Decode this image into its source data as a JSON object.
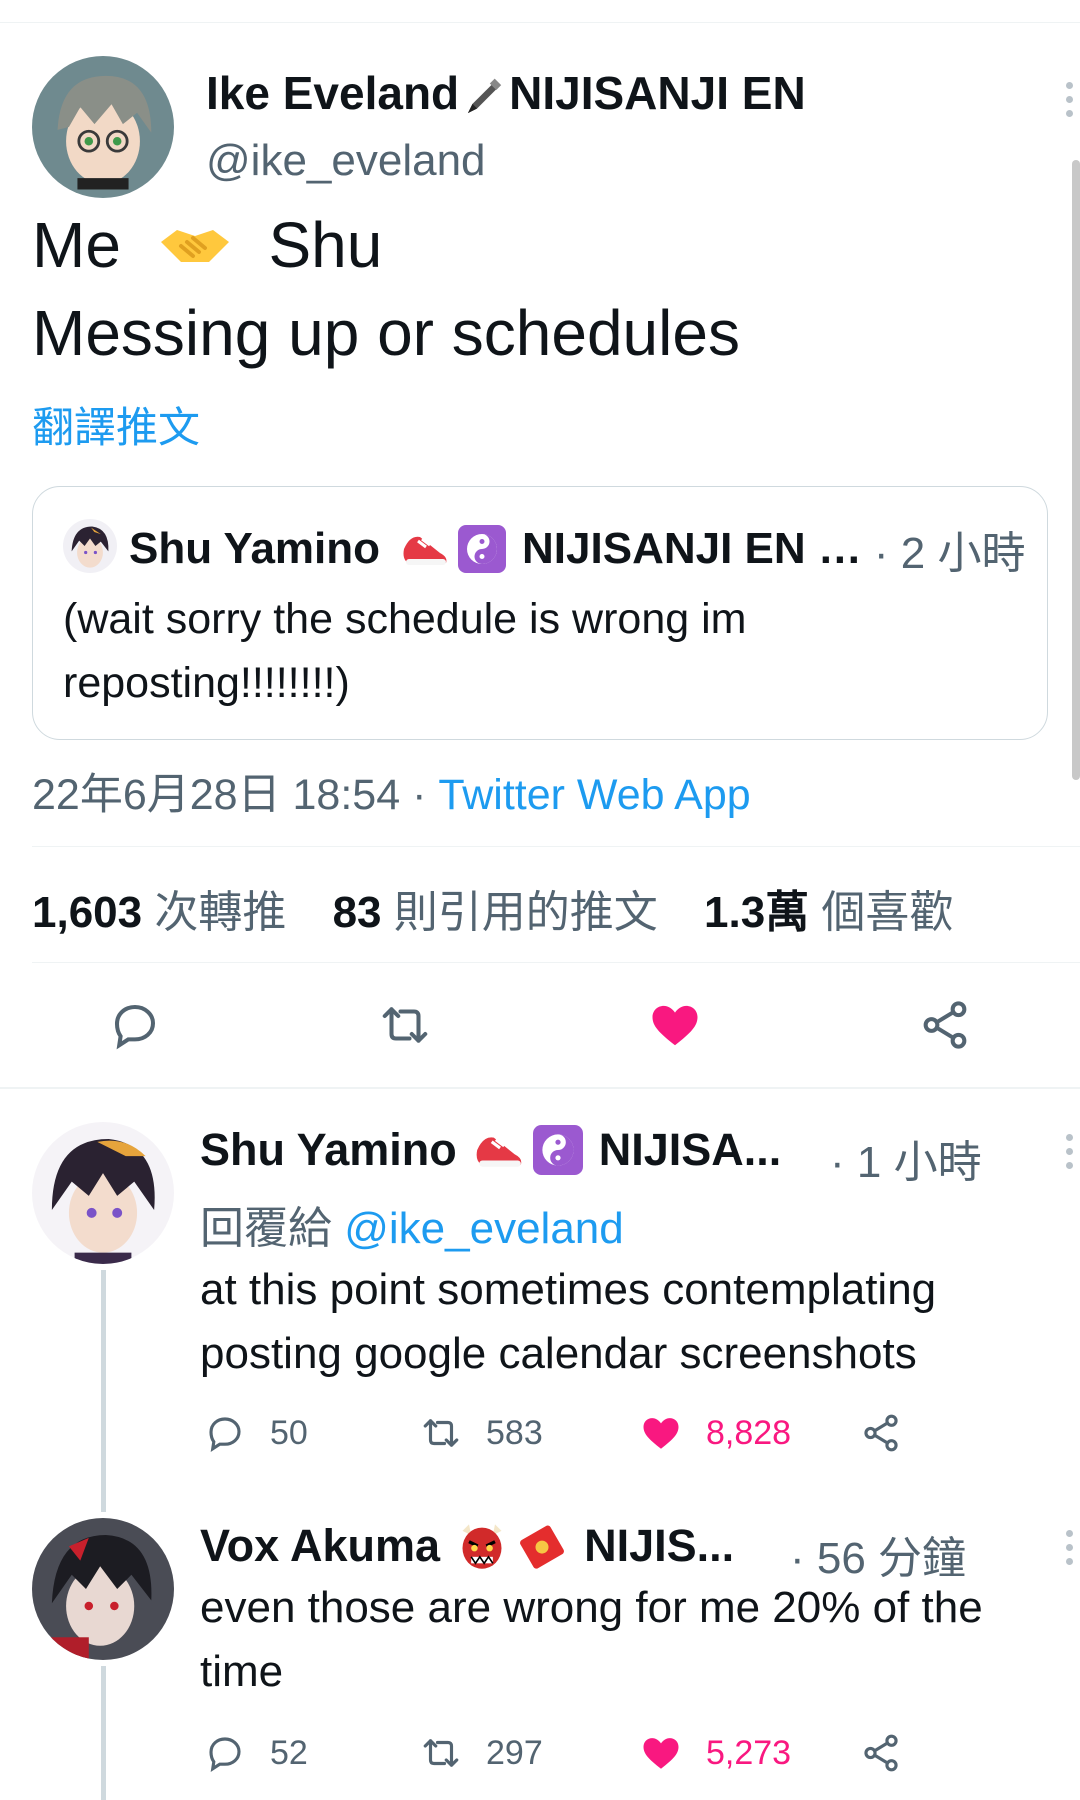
{
  "main_tweet": {
    "author_name": "Ike Eveland",
    "name_emoji": "🖋",
    "org": "NIJISANJI EN",
    "handle": "@ike_eveland",
    "text_line1_a": "Me",
    "text_line1_emoji": "🤝",
    "text_line1_b": "Shu",
    "text_line2": "Messing up or schedules",
    "translate_label": "翻譯推文",
    "timestamp": "22年6月28日 18:54",
    "separator": "·",
    "source_app": "Twitter Web App",
    "stats": {
      "retweets_count": "1,603",
      "retweets_label": "次轉推",
      "quotes_count": "83",
      "quotes_label": "則引用的推文",
      "likes_count": "1.3萬",
      "likes_label": "個喜歡"
    }
  },
  "quoted_tweet": {
    "author_name": "Shu Yamino",
    "org_truncated": "NIJISANJI EN …",
    "dot": "·",
    "time": "2 小時",
    "text": "(wait sorry the schedule is wrong im reposting!!!!!!!!)"
  },
  "replies": [
    {
      "author_name": "Shu Yamino",
      "org_truncated": "NIJISA...",
      "time": "· 1 小時",
      "reply_prefix": "回覆給",
      "reply_to": "@ike_eveland",
      "text": "at this point sometimes contemplating posting google calendar screenshots",
      "reply_count": "50",
      "retweet_count": "583",
      "like_count": "8,828"
    },
    {
      "author_name": "Vox Akuma",
      "org_truncated": "NIJIS...",
      "time": "· 56 分鐘",
      "text": "even those are wrong for me 20% of the time",
      "reply_count": "52",
      "retweet_count": "297",
      "like_count": "5,273"
    }
  ],
  "colors": {
    "link_blue": "#1d9bf0",
    "like_pink": "#f91880",
    "muted": "#536471",
    "border": "#cfd9de"
  },
  "icons": [
    "more-icon",
    "reply-icon",
    "retweet-icon",
    "like-icon",
    "share-icon",
    "sneaker-icon",
    "yin-yang-icon",
    "oni-mask-icon",
    "red-envelope-icon",
    "handshake-icon",
    "pen-icon"
  ]
}
